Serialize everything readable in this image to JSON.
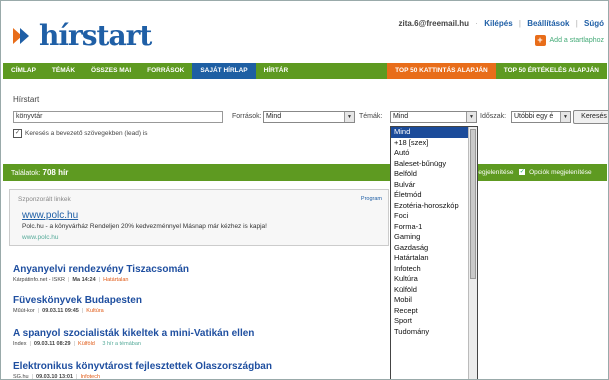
{
  "header": {
    "logo_text": "hírstart",
    "user_email": "zita.6@freemail.hu",
    "logout": "Kilépés",
    "settings": "Beállítások",
    "help": "Súgó",
    "add_start": "Add a startlaphoz"
  },
  "nav": {
    "items": [
      "CÍMLAP",
      "TÉMÁK",
      "ÖSSZES MAI",
      "FORRÁSOK",
      "SAJÁT HÍRLAP",
      "HÍRTÁR",
      "TOP 50 KATTINTÁS ALAPJÁN",
      "TOP 50 ÉRTÉKELÉS ALAPJÁN"
    ]
  },
  "search": {
    "label": "Hírstart",
    "query": "könyvtár",
    "sources_label": "Források:",
    "sources_value": "Mind",
    "topics_label": "Témák:",
    "topics_value": "Mind",
    "period_label": "Időszak:",
    "period_value": "Utóbbi egy é",
    "button": "Keresés",
    "lead_checkbox": "Keresés a bevezető szövegekben (lead) is"
  },
  "results_band": {
    "prefix": "Találatok:",
    "count": "708 hír",
    "right_text": "megjelenítése",
    "options": "Opciók megjelenítése"
  },
  "sponsored": {
    "title": "Szponzorált linkek",
    "program": "Program",
    "link": "www.polc.hu",
    "text": "Polc.hu - a könyvárház Rendeljen 20% kedvezménnyel Másnap már kézhez is kapja!",
    "url": "www.polc.hu"
  },
  "results": [
    {
      "title": "Anyanyelvi rendezvény Tiszacsomán",
      "source": "Kárpátinfo.net - ISKR",
      "time": "Ma 14:24",
      "category": "Határtalan",
      "extra": ""
    },
    {
      "title": "Füveskönyvek Budapesten",
      "source": "Műút-kor",
      "time": "09.03.11 09:45",
      "category": "Kultúra",
      "extra": ""
    },
    {
      "title": "A spanyol szocialisták kikeltek a mini-Vatikán ellen",
      "source": "Index",
      "time": "09.03.11 08:29",
      "category": "Külföld",
      "extra": "3 hír a témában"
    },
    {
      "title": "Elektronikus könyvtárost fejlesztettek Olaszországban",
      "source": "SG.hu",
      "time": "09.03.10 13:01",
      "category": "Infotech",
      "extra": ""
    }
  ],
  "topics_dropdown": {
    "selected_index": 0,
    "options": [
      "Mind",
      "+18 [szex]",
      "Autó",
      "Baleset-bűnügy",
      "Belföld",
      "Bulvár",
      "Életmód",
      "Ezotéria-horoszkóp",
      "Foci",
      "Forma-1",
      "Gaming",
      "Gazdaság",
      "Határtalan",
      "Infotech",
      "Kultúra",
      "Külföld",
      "Mobil",
      "Recept",
      "Sport",
      "Tudomány"
    ]
  },
  "colors": {
    "nav_green": "#5e9a21",
    "nav_blue": "#1e5fa3",
    "nav_orange": "#e86d1a",
    "link_blue": "#1f4fa0",
    "dropdown_selected": "#1b4b9a"
  },
  "icons": {
    "logo": "arrow-logo-icon",
    "add": "plus-icon",
    "select_arrow": "chevron-down-icon",
    "checkbox": "check-icon"
  }
}
